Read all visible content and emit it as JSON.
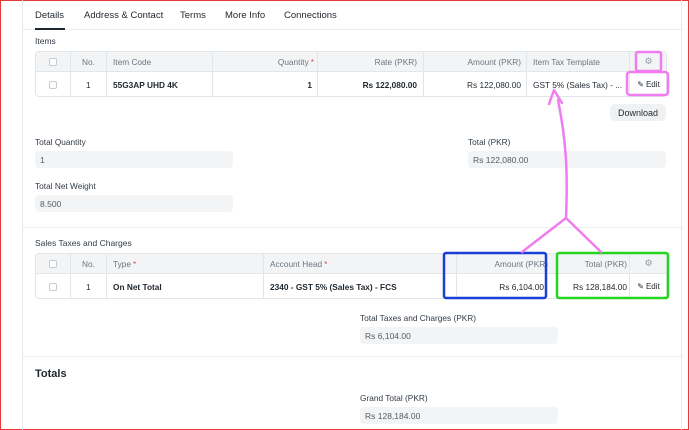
{
  "tabs": [
    "Details",
    "Address & Contact",
    "Terms",
    "More Info",
    "Connections"
  ],
  "items": {
    "section_label": "Items",
    "columns": {
      "no": "No.",
      "item_code": "Item Code",
      "quantity": "Quantity",
      "rate": "Rate (PKR)",
      "amount": "Amount (PKR)",
      "tax_template": "Item Tax Template",
      "required_mark": "*"
    },
    "row": {
      "no": "1",
      "item_code": "55G3AP UHD 4K",
      "quantity": "1",
      "rate": "Rs 122,080.00",
      "amount": "Rs 122,080.00",
      "tax_template": "GST 5% (Sales Tax) - ...",
      "edit": "Edit"
    },
    "download_label": "Download"
  },
  "totals_fields": {
    "total_quantity_label": "Total Quantity",
    "total_quantity_value": "1",
    "total_label": "Total (PKR)",
    "total_value": "Rs 122,080.00",
    "total_net_weight_label": "Total Net Weight",
    "total_net_weight_value": "8.500"
  },
  "taxes": {
    "section_label": "Sales Taxes and Charges",
    "columns": {
      "no": "No.",
      "type": "Type",
      "account_head": "Account Head",
      "amount": "Amount (PKR)",
      "total": "Total (PKR)",
      "required_mark": "*"
    },
    "row": {
      "no": "1",
      "type": "On Net Total",
      "account_head": "2340 - GST 5% (Sales Tax) - FCS",
      "amount": "Rs 6,104.00",
      "total": "Rs 128,184.00",
      "edit": "Edit"
    },
    "total_taxes_label": "Total Taxes and Charges (PKR)",
    "total_taxes_value": "Rs 6,104.00"
  },
  "totals_section": {
    "heading": "Totals",
    "grand_total_label": "Grand Total (PKR)",
    "grand_total_value": "Rs 128,184.00"
  },
  "annotation_colors": {
    "magenta": "#f07cf0",
    "blue": "#1a3fd8",
    "green": "#22d622",
    "frame": "#e53935"
  }
}
